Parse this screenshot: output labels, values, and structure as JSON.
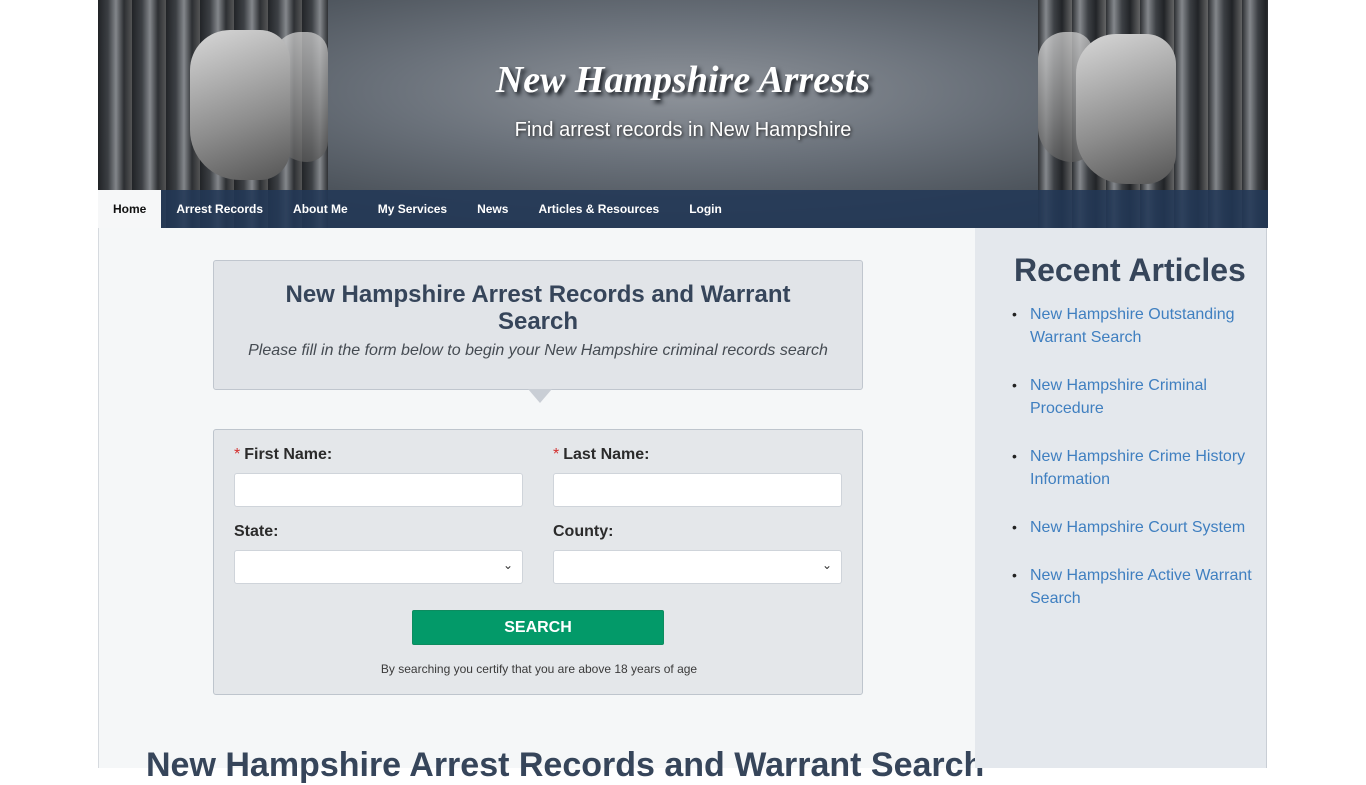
{
  "header": {
    "title": "New Hampshire Arrests",
    "tagline": "Find arrest records in New Hampshire"
  },
  "nav": {
    "items": [
      {
        "label": "Home",
        "active": true
      },
      {
        "label": "Arrest Records"
      },
      {
        "label": "About Me"
      },
      {
        "label": "My Services"
      },
      {
        "label": "News"
      },
      {
        "label": "Articles & Resources"
      },
      {
        "label": "Login"
      }
    ]
  },
  "intro": {
    "title": "New Hampshire Arrest Records and Warrant Search",
    "subtitle": "Please fill in the form below to begin your New Hampshire criminal records search"
  },
  "form": {
    "required_marker": "*",
    "first_name_label": "First Name:",
    "first_name_value": "",
    "last_name_label": "Last Name:",
    "last_name_value": "",
    "state_label": "State:",
    "state_value": "",
    "county_label": "County:",
    "county_value": "",
    "dropdown_icon": "chevron-down-icon",
    "search_label": "SEARCH",
    "disclaimer": "By searching you certify that you are above 18 years of age",
    "button_color": "#039a69"
  },
  "main": {
    "heading": "New Hampshire Arrest Records and Warrant Search"
  },
  "sidebar": {
    "title": "Recent Articles",
    "articles": [
      "New Hampshire Outstanding Warrant Search",
      "New Hampshire Criminal Procedure",
      "New Hampshire Crime History Information",
      "New Hampshire Court System",
      "New Hampshire Active Warrant Search"
    ],
    "link_color": "#3f7fc0"
  }
}
